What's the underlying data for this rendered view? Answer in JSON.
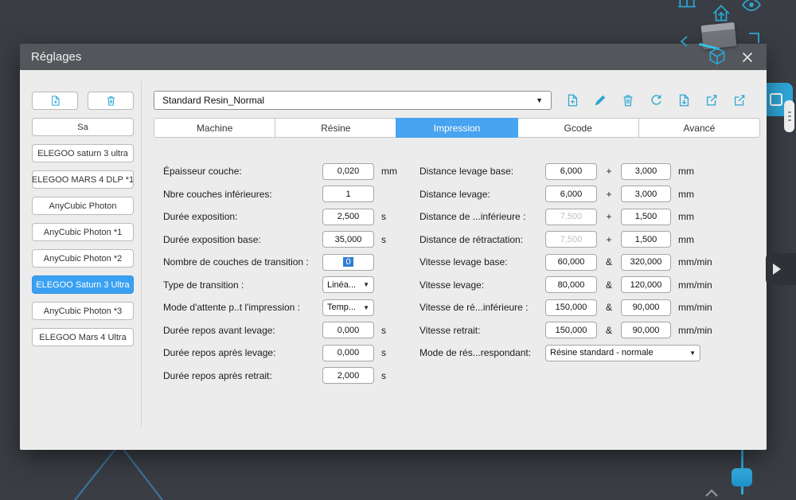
{
  "window": {
    "title": "Réglages"
  },
  "icons": {
    "caret_down": "▼"
  },
  "preset": {
    "value": "Standard Resin_Normal"
  },
  "profile_toolbar": {
    "buttons": [
      {
        "name": "new-resin-profile-button",
        "glyph": "doc-plus"
      },
      {
        "name": "rename-profile-button",
        "glyph": "pencil"
      },
      {
        "name": "delete-resin-profile-button",
        "glyph": "trash"
      },
      {
        "name": "reset-profile-button",
        "glyph": "sync"
      },
      {
        "name": "save-profile-button",
        "glyph": "doc-down"
      },
      {
        "name": "export-profile-button",
        "glyph": "box-arrow"
      },
      {
        "name": "share-profile-button",
        "glyph": "box-arrow"
      }
    ]
  },
  "tabs": {
    "labels": [
      "Machine",
      "Résine",
      "Impression",
      "Gcode",
      "Avancé"
    ],
    "selected_index": 2
  },
  "sidebar": {
    "buttons": [
      {
        "name": "add-machine-button",
        "glyph": "doc-plus"
      },
      {
        "name": "delete-machine-button",
        "glyph": "trash"
      }
    ],
    "profiles": [
      "Sa",
      "ELEGOO saturn 3 ultra",
      "ELEGOO MARS 4 DLP *1",
      "AnyCubic Photon",
      "AnyCubic Photon *1",
      "AnyCubic Photon *2",
      "ELEGOO Saturn 3 Ultra",
      "AnyCubic Photon *3",
      "ELEGOO Mars 4 Ultra"
    ],
    "selected_index": 6
  },
  "form": {
    "left": [
      {
        "label": "Épaisseur couche:",
        "value": "0,020",
        "unit": "mm"
      },
      {
        "label": "Nbre couches inférieures:",
        "value": "1",
        "unit": ""
      },
      {
        "label": "Durée exposition:",
        "value": "2,500",
        "unit": "s"
      },
      {
        "label": "Durée exposition base:",
        "value": "35,000",
        "unit": "s"
      },
      {
        "label": "Nombre de couches de transition :",
        "value": "0",
        "unit": "",
        "text_selected": true
      },
      {
        "label": "Type de transition :",
        "control": "select",
        "value": "Linéa..."
      },
      {
        "label": "Mode d'attente p..t l'impression :",
        "control": "select",
        "value": "Temp..."
      },
      {
        "label": "Durée repos avant levage:",
        "value": "0,000",
        "unit": "s"
      },
      {
        "label": "Durée repos après levage:",
        "value": "0,000",
        "unit": "s"
      },
      {
        "label": "Durée repos après retrait:",
        "value": "2,000",
        "unit": "s"
      }
    ],
    "right": [
      {
        "label": "Distance levage base:",
        "v1": "6,000",
        "sep": "+",
        "v2": "3,000",
        "unit": "mm"
      },
      {
        "label": "Distance levage:",
        "v1": "6,000",
        "sep": "+",
        "v2": "3,000",
        "unit": "mm"
      },
      {
        "label": "Distance de ...inférieure :",
        "v1": "7,500",
        "sep": "+",
        "v2": "1,500",
        "unit": "mm",
        "v1_disabled": true
      },
      {
        "label": "Distance de rétractation:",
        "v1": "7,500",
        "sep": "+",
        "v2": "1,500",
        "unit": "mm",
        "v1_disabled": true
      },
      {
        "label": "Vitesse levage base:",
        "v1": "60,000",
        "sep": "&",
        "v2": "320,000",
        "unit": "mm/min"
      },
      {
        "label": "Vitesse levage:",
        "v1": "80,000",
        "sep": "&",
        "v2": "120,000",
        "unit": "mm/min"
      },
      {
        "label": "Vitesse de ré...inférieure :",
        "v1": "150,000",
        "sep": "&",
        "v2": "90,000",
        "unit": "mm/min"
      },
      {
        "label": "Vitesse retrait:",
        "v1": "150,000",
        "sep": "&",
        "v2": "90,000",
        "unit": "mm/min"
      },
      {
        "label": "Mode de rés...respondant:",
        "control": "select",
        "value": "Résine standard - normale"
      }
    ]
  },
  "colors": {
    "accent_teal": "#2ba6d4",
    "selected_blue": "#48a3f0",
    "titlebar": "#53565b",
    "background": "#3a3e44"
  }
}
